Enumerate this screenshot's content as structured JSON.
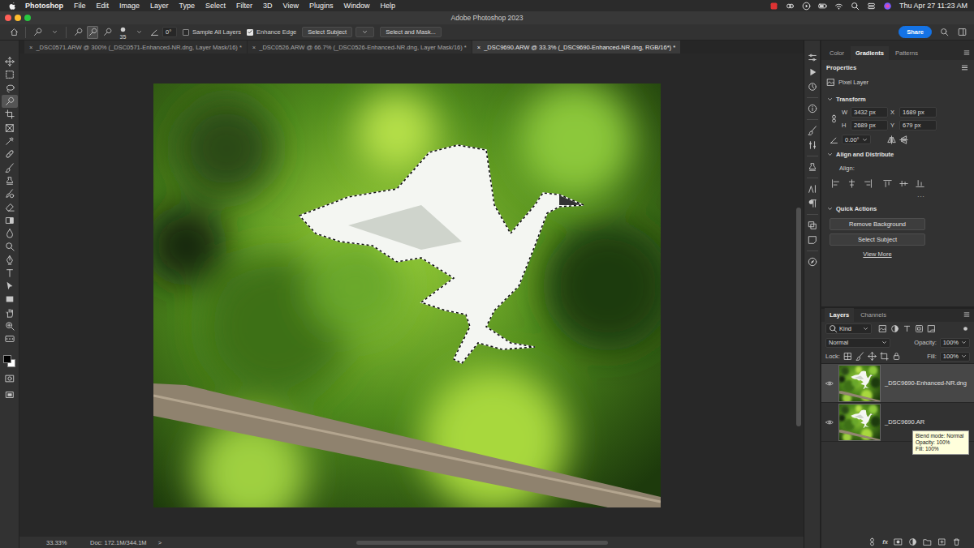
{
  "menubar": {
    "app": "Photoshop",
    "items": [
      "File",
      "Edit",
      "Image",
      "Layer",
      "Type",
      "Select",
      "Filter",
      "3D",
      "View",
      "Plugins",
      "Window",
      "Help"
    ],
    "clock": "Thu Apr 27 11:23 AM"
  },
  "window": {
    "title": "Adobe Photoshop 2023"
  },
  "options_bar": {
    "selection_modes": [
      {
        "selected": false
      },
      {
        "selected": true
      },
      {
        "selected": false
      }
    ],
    "brush_size": "35",
    "angle": "0°",
    "sample_all_layers": {
      "label": "Sample All Layers",
      "checked": false
    },
    "enhance_edge": {
      "label": "Enhance Edge",
      "checked": true
    },
    "select_subject": "Select Subject",
    "select_and_mask": "Select and Mask...",
    "share": "Share"
  },
  "document_tabs": [
    {
      "label": "_DSC0571.ARW @ 300% (_DSC0571-Enhanced-NR.dng, Layer Mask/16) *",
      "close": "×",
      "selected": false
    },
    {
      "label": "_DSC0526.ARW @ 66.7% (_DSC0526-Enhanced-NR.dng, Layer Mask/16) *",
      "close": "×",
      "selected": false
    },
    {
      "label": "_DSC9690.ARW @ 33.3% (_DSC9690-Enhanced-NR.dng, RGB/16*) *",
      "close": "×",
      "selected": true
    }
  ],
  "tools": [
    {
      "selected": false
    },
    {
      "selected": false
    },
    {
      "selected": false
    },
    {
      "selected": true
    },
    {
      "selected": false
    },
    {
      "selected": false
    },
    {
      "selected": false
    },
    {
      "selected": false
    },
    {
      "selected": false
    },
    {
      "selected": false
    },
    {
      "selected": false
    },
    {
      "selected": false
    },
    {
      "selected": false
    },
    {
      "selected": false
    },
    {
      "selected": false
    },
    {
      "selected": false
    },
    {
      "selected": false
    },
    {
      "selected": false
    },
    {
      "selected": false
    },
    {
      "selected": false
    },
    {
      "selected": false
    },
    {
      "selected": false
    }
  ],
  "status_bar": {
    "zoom": "33.33%",
    "doc": "Doc: 172.1M/344.1M",
    "arrow": ">"
  },
  "panel_tabs": [
    {
      "label": "Color",
      "selected": false
    },
    {
      "label": "Gradients",
      "selected": true
    },
    {
      "label": "Patterns",
      "selected": false
    }
  ],
  "properties": {
    "title": "Properties",
    "layer_kind": "Pixel Layer",
    "transform": {
      "title": "Transform",
      "expanded": true,
      "fields": [
        {
          "label": "W",
          "value": "3432 px"
        },
        {
          "label": "X",
          "value": "1689 px"
        },
        {
          "label": "H",
          "value": "2689 px"
        },
        {
          "label": "Y",
          "value": "679 px"
        }
      ],
      "angle": "0.00°"
    },
    "align": {
      "title": "Align and Distribute",
      "expanded": true,
      "label": "Align:",
      "more": "..."
    },
    "quick_actions": {
      "title": "Quick Actions",
      "expanded": true,
      "buttons": [
        "Remove Background",
        "Select Subject"
      ],
      "link": "View More"
    }
  },
  "layers_panel": {
    "tabs": [
      {
        "label": "Layers",
        "selected": true
      },
      {
        "label": "Channels",
        "selected": false
      }
    ],
    "filter": "Kind",
    "blend_mode": "Normal",
    "opacity_label": "Opacity:",
    "opacity": "100%",
    "lock_label": "Lock:",
    "fill_label": "Fill:",
    "fill": "100%",
    "fx": "fx",
    "layers": [
      {
        "name": "_DSC9690-Enhanced-NR.dng",
        "visible": true,
        "selected": true
      },
      {
        "name": "_DSC9690.AR",
        "visible": true,
        "selected": false
      }
    ]
  },
  "tooltip": {
    "lines": [
      "Blend mode: Normal",
      "Opacity: 100%",
      "Fill: 100%"
    ]
  }
}
